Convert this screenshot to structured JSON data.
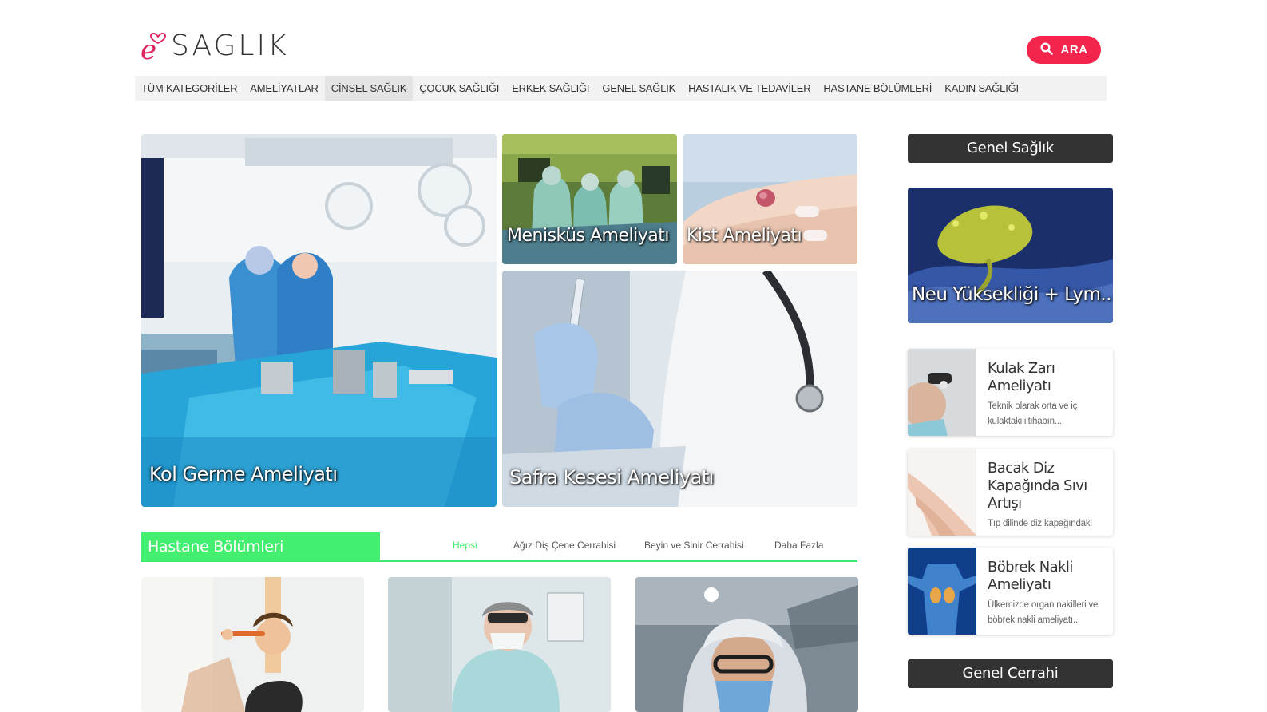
{
  "header": {
    "logo_text": "SAGLIK",
    "search_label": "ARA"
  },
  "nav": {
    "items": [
      {
        "label": "TÜM KATEGORİLER",
        "active": false
      },
      {
        "label": "AMELİYATLAR",
        "active": false
      },
      {
        "label": "CİNSEL SAĞLIK",
        "active": true
      },
      {
        "label": "ÇOCUK SAĞLIĞI",
        "active": false
      },
      {
        "label": "ERKEK SAĞLIĞI",
        "active": false
      },
      {
        "label": "GENEL SAĞLIK",
        "active": false
      },
      {
        "label": "HASTALIK VE TEDAVİLER",
        "active": false
      },
      {
        "label": "HASTANE BÖLÜMLERİ",
        "active": false
      },
      {
        "label": "KADIN SAĞLIĞI",
        "active": false
      }
    ]
  },
  "featured": {
    "main": "Kol Germe Ameliyatı",
    "top_left": "Menisküs Ameliyatı",
    "top_right": "Kist Ameliyatı",
    "bottom": "Safra Kesesi Ameliyatı"
  },
  "section": {
    "title": "Hastane Bölümleri",
    "tabs": [
      "Hepsi",
      "Ağız Diş Çene Cerrahisi",
      "Beyin ve Sinir Cerrahisi",
      "Daha Fazla"
    ]
  },
  "sidebar": {
    "heading": "Genel Sağlık",
    "feature_title": "Neu Yüksekliği + Lym...",
    "items": [
      {
        "title": "Kulak Zarı Ameliyatı",
        "desc": "Teknik olarak orta ve iç kulaktaki iltihabın..."
      },
      {
        "title": "Bacak Diz Kapağında Sıvı Artışı",
        "desc": "Tıp dilinde diz kapağındaki"
      },
      {
        "title": "Böbrek Nakli Ameliyatı",
        "desc": "Ülkemizde organ nakilleri ve böbrek nakli ameliyatı..."
      }
    ],
    "heading2": "Genel Cerrahi"
  },
  "colors": {
    "accent_red": "#f4254d",
    "accent_green": "#44ee6f",
    "dark_header": "#333333"
  }
}
